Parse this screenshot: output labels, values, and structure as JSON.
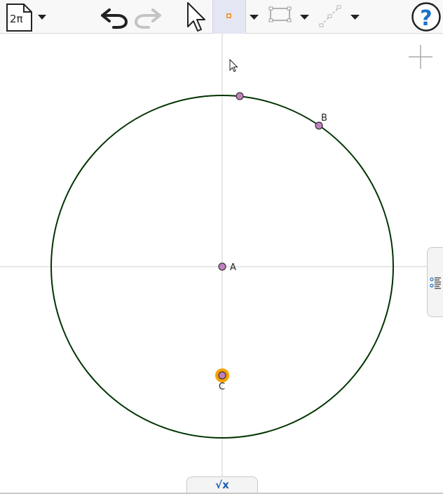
{
  "toolbar": {
    "menu_label": "2π",
    "tools": [
      {
        "name": "undo",
        "icon": "undo-icon"
      },
      {
        "name": "redo",
        "icon": "redo-icon"
      },
      {
        "name": "move",
        "icon": "arrow-cursor-icon"
      },
      {
        "name": "point",
        "icon": "point-icon",
        "selected": true
      },
      {
        "name": "polygon",
        "icon": "polygon-icon"
      },
      {
        "name": "segment",
        "icon": "segment-icon"
      }
    ],
    "help_label": "?"
  },
  "graphics": {
    "points": [
      {
        "name": "A",
        "label": "A"
      },
      {
        "name": "B",
        "label": "B"
      },
      {
        "name": "C",
        "label": "C",
        "highlighted": true
      }
    ],
    "colors": {
      "circle": "#003300",
      "point_fill": "#c080c0",
      "highlight": "#f5a300",
      "axes": "#d0d0d0"
    }
  },
  "algebra_tab": {
    "label": "√x"
  }
}
